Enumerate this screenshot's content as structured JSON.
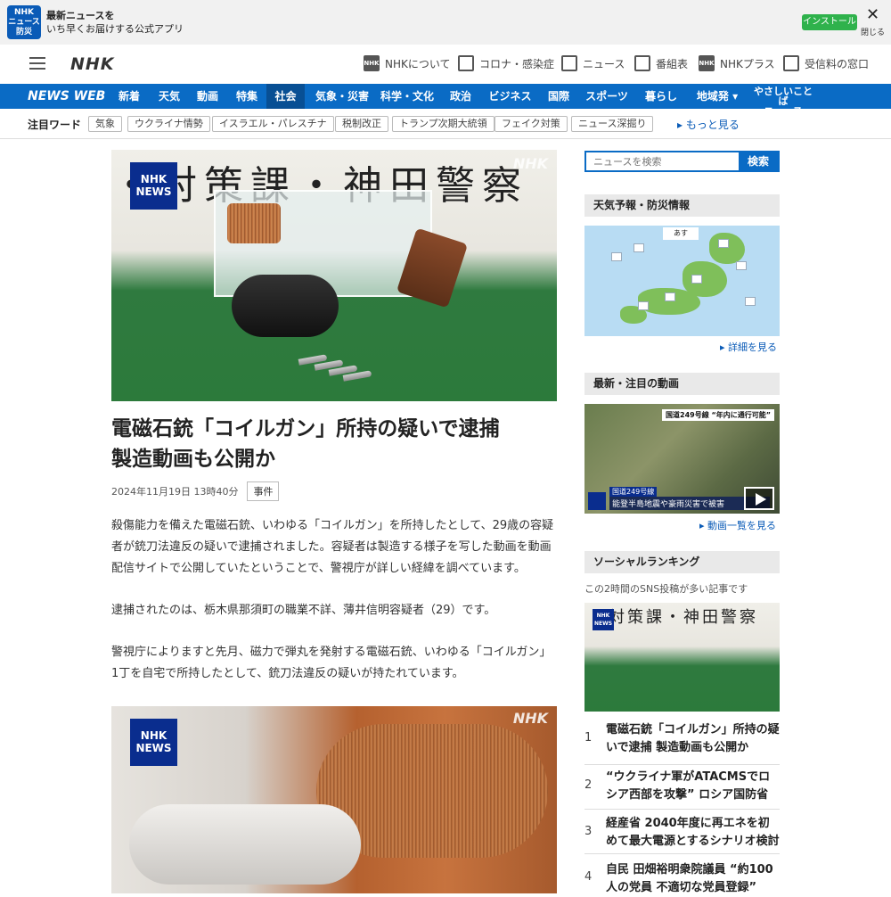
{
  "banner": {
    "logo_line1": "NHK",
    "logo_line2": "ニュース",
    "logo_line3": "防災",
    "text_line1": "最新ニュースを",
    "text_line2": "いち早くお届けする公式アプリ",
    "install_label": "インストール",
    "close_label": "閉じる"
  },
  "header": {
    "logo": "NHK",
    "links": [
      {
        "label": "NHKについて",
        "icon": "nhk-icon"
      },
      {
        "label": "コロナ・感染症",
        "icon": "virus-icon"
      },
      {
        "label": "ニュース",
        "icon": "news-icon"
      },
      {
        "label": "番組表",
        "icon": "schedule-icon"
      },
      {
        "label": "NHKプラス",
        "icon": "nhkplus-icon"
      },
      {
        "label": "受信料の窓口",
        "icon": "reception-icon"
      }
    ]
  },
  "nav": {
    "brand": "NEWS WEB",
    "items": [
      "新着",
      "天気",
      "動画",
      "特集",
      "社会",
      "気象・災害",
      "科学・文化",
      "政治",
      "ビジネス",
      "国際",
      "スポーツ",
      "暮らし",
      "地域発 ▾"
    ],
    "easy_line1": "やさしいことば",
    "easy_line2": "ニュース",
    "active": "社会"
  },
  "trend": {
    "label": "注目ワード",
    "tags": [
      "気象",
      "ウクライナ情勢",
      "イスラエル・パレスチナ",
      "税制改正",
      "トランプ次期大統領",
      "フェイク対策",
      "ニュース深掘り"
    ],
    "more": "▸ もっと見る"
  },
  "article": {
    "hero_overlay": "・対策課・神田警察",
    "badge_line1": "NHK",
    "badge_line2": "NEWS",
    "watermark": "NHK",
    "headline_line1": "電磁石銃「コイルガン」所持の疑いで逮捕",
    "headline_line2": "製造動画も公開か",
    "date": "2024年11月19日 13時40分",
    "category": "事件",
    "paragraphs": [
      "殺傷能力を備えた電磁石銃、いわゆる「コイルガン」を所持したとして、29歳の容疑者が銃刀法違反の疑いで逮捕されました。容疑者は製造する様子を写した動画を動画配信サイトで公開していたということで、警視庁が詳しい経緯を調べています。",
      "逮捕されたのは、栃木県那須町の職業不詳、薄井信明容疑者（29）です。",
      "警視庁によりますと先月、磁力で弾丸を発射する電磁石銃、いわゆる「コイルガン」1丁を自宅で所持したとして、銃刀法違反の疑いが持たれています。"
    ],
    "photo2_badge_line1": "NHK",
    "photo2_badge_line2": "NEWS",
    "photo2_watermark": "NHK"
  },
  "sidebar": {
    "search_placeholder": "ニュースを検索",
    "search_button": "検索",
    "weather_title": "天気予報・防災情報",
    "weather_tab": "あす",
    "weather_more": "▸ 詳細を見る",
    "video_title": "最新・注目の動画",
    "video_caption_top": "国道249号線 “年内に通行可能”",
    "video_caption_tag": "国道249号線",
    "video_caption_bottom": "能登半島地震や豪雨災害で被害",
    "video_more": "▸ 動画一覧を見る",
    "ranking_title": "ソーシャルランキング",
    "ranking_note": "この2時間のSNS投稿が多い記事です",
    "ranking_img_text": "・対策課・神田警察",
    "ranking": [
      {
        "num": "1",
        "title": "電磁石銃「コイルガン」所持の疑いで逮捕 製造動画も公開か"
      },
      {
        "num": "2",
        "title": "“ウクライナ軍がATACMSでロシア西部を攻撃” ロシア国防省"
      },
      {
        "num": "3",
        "title": "経産省 2040年度に再エネを初めて最大電源とするシナリオ検討"
      },
      {
        "num": "4",
        "title": "自民 田畑裕明衆院議員 “約100人の党員 不適切な党員登録”"
      }
    ]
  }
}
